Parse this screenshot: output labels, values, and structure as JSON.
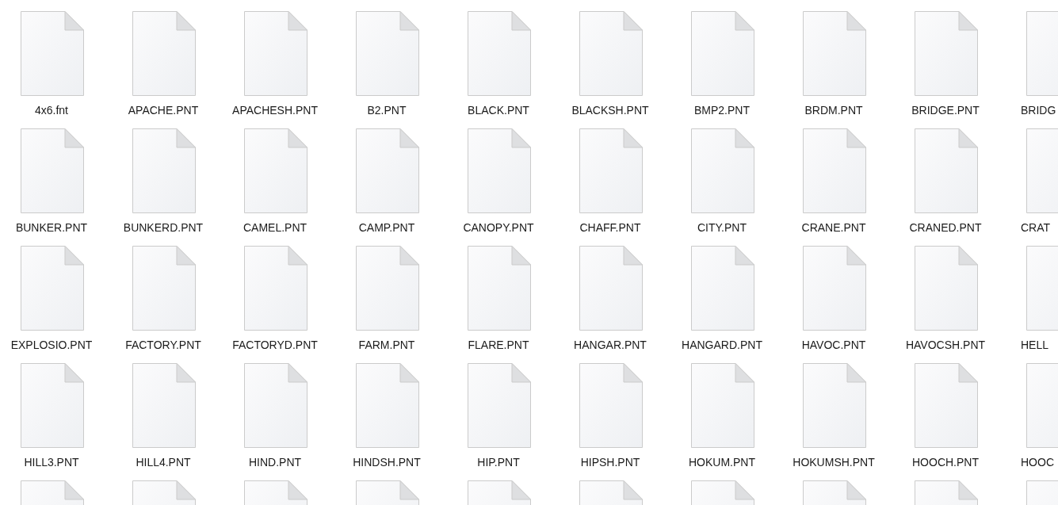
{
  "file_rows": [
    {
      "files": [
        "4x6.fnt",
        "APACHE.PNT",
        "APACHESH.PNT",
        "B2.PNT",
        "BLACK.PNT",
        "BLACKSH.PNT",
        "BMP2.PNT",
        "BRDM.PNT",
        "BRIDGE.PNT",
        "BRIDG"
      ]
    },
    {
      "files": [
        "BUNKER.PNT",
        "BUNKERD.PNT",
        "CAMEL.PNT",
        "CAMP.PNT",
        "CANOPY.PNT",
        "CHAFF.PNT",
        "CITY.PNT",
        "CRANE.PNT",
        "CRANED.PNT",
        "CRAT"
      ]
    },
    {
      "files": [
        "EXPLOSIO.PNT",
        "FACTORY.PNT",
        "FACTORYD.PNT",
        "FARM.PNT",
        "FLARE.PNT",
        "HANGAR.PNT",
        "HANGARD.PNT",
        "HAVOC.PNT",
        "HAVOCSH.PNT",
        "HELL"
      ]
    },
    {
      "files": [
        "HILL3.PNT",
        "HILL4.PNT",
        "HIND.PNT",
        "HINDSH.PNT",
        "HIP.PNT",
        "HIPSH.PNT",
        "HOKUM.PNT",
        "HOKUMSH.PNT",
        "HOOCH.PNT",
        "HOOC"
      ]
    }
  ]
}
